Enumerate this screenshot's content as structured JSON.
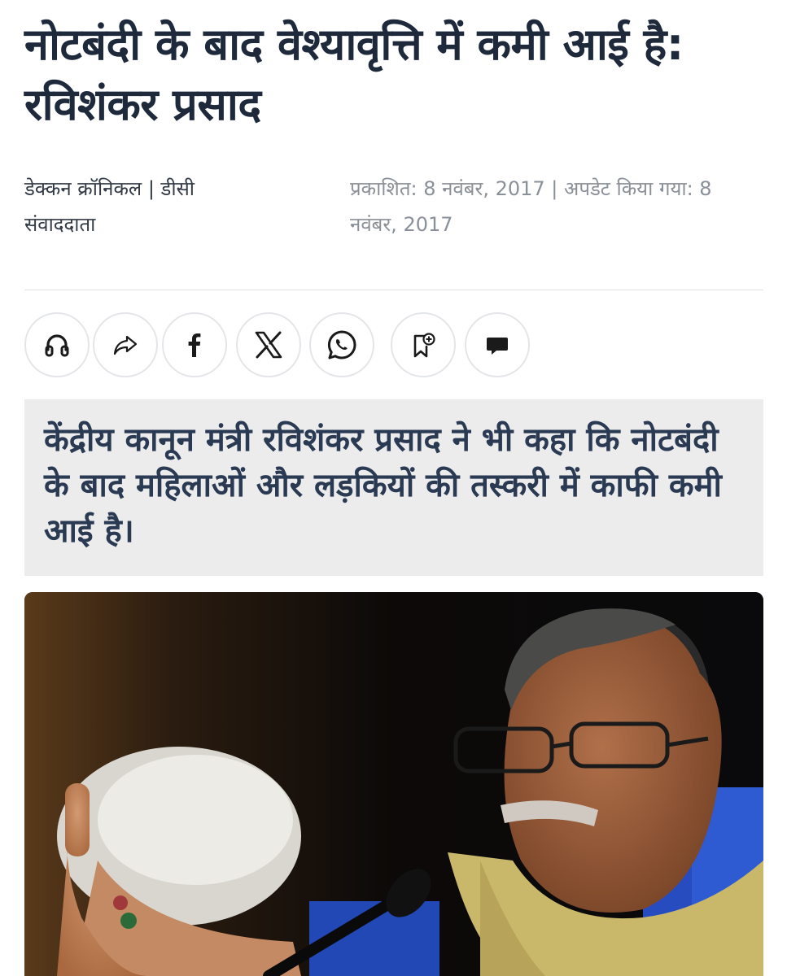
{
  "article": {
    "headline": "नोटबंदी के बाद वेश्यावृत्ति में कमी आई है: रविशंकर प्रसाद",
    "byline": "डेक्कन क्रॉनिकल | डीसी संवाददाता",
    "dates": "प्रकाशित: 8 नवंबर, 2017 | अपडेट किया गया: 8 नवंबर, 2017",
    "summary": "केंद्रीय कानून मंत्री रविशंकर प्रसाद ने भी कहा कि नोटबंदी के बाद महिलाओं और लड़कियों की तस्करी में काफी कमी आई है।"
  },
  "share_bar": {
    "buttons": [
      {
        "icon": "headphones-icon"
      },
      {
        "icon": "share-arrow-icon"
      },
      {
        "icon": "facebook-icon"
      },
      {
        "icon": "x-icon"
      },
      {
        "icon": "whatsapp-icon"
      },
      {
        "icon": "bookmark-add-icon"
      },
      {
        "icon": "comment-icon"
      }
    ]
  },
  "colors": {
    "headline": "#1e2a3c",
    "summary_bg": "#ececed",
    "summary_text": "#2a3a52",
    "dates_text": "#8a9099",
    "button_border": "#e3e5e8"
  },
  "photo": {
    "subject": "article-photo"
  }
}
